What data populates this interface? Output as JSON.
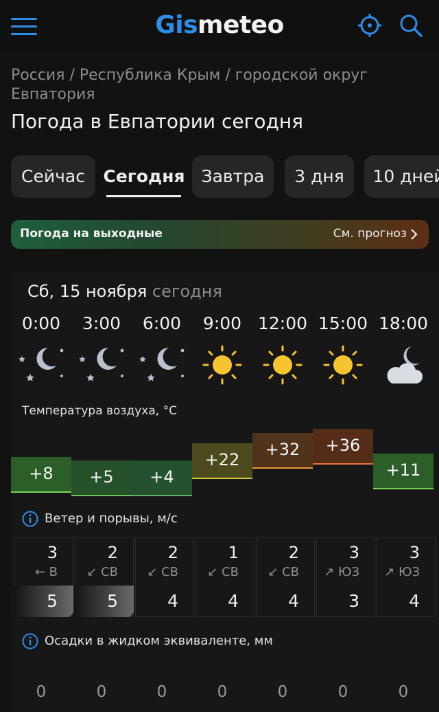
{
  "header": {
    "logo_part1": "Gis",
    "logo_part2": "meteo",
    "menu_icon": "hamburger-menu-icon",
    "locate_icon": "crosshair-location-icon",
    "search_icon": "search-icon",
    "accent_color": "#2f8ce8"
  },
  "breadcrumb": {
    "path": "Россия / Республика Крым / городской округ Евпатория"
  },
  "page_title": "Погода в Евпатории сегодня",
  "tabs": [
    {
      "label": "Сейчас",
      "active": false
    },
    {
      "label": "Сегодня",
      "active": true
    },
    {
      "label": "Завтра",
      "active": false
    },
    {
      "label": "3 дня",
      "active": false
    },
    {
      "label": "10 дней",
      "active": false
    }
  ],
  "weekend_banner": {
    "title": "Погода на выходные",
    "link": "См. прогноз"
  },
  "forecast": {
    "date": "Сб, 15 ноября",
    "today_label": "сегодня",
    "times": [
      "0:00",
      "3:00",
      "6:00",
      "9:00",
      "12:00",
      "15:00",
      "18:00"
    ],
    "icons": [
      "moon-stars-icon",
      "moon-stars-icon",
      "moon-stars-icon",
      "sun-icon",
      "sun-icon",
      "sun-icon",
      "moon-cloud-icon"
    ],
    "temperature_label": "Температура воздуха, °C",
    "temperatures": [
      "+8",
      "+5",
      "+4",
      "+22",
      "+32",
      "+36",
      "+11"
    ],
    "wind_label": "Ветер и порывы, м/с",
    "wind_speeds": [
      "3",
      "2",
      "2",
      "1",
      "2",
      "3",
      "3"
    ],
    "wind_dirs": [
      "← В",
      "↙ СВ",
      "↙ СВ",
      "↙ СВ",
      "↙ СВ",
      "↗ ЮЗ",
      "↗ ЮЗ"
    ],
    "gusts": [
      "5",
      "5",
      "4",
      "4",
      "4",
      "3",
      "4"
    ],
    "precip_label": "Осадки в жидком эквиваленте, мм",
    "precip": [
      "0",
      "0",
      "0",
      "0",
      "0",
      "0",
      "0"
    ]
  }
}
